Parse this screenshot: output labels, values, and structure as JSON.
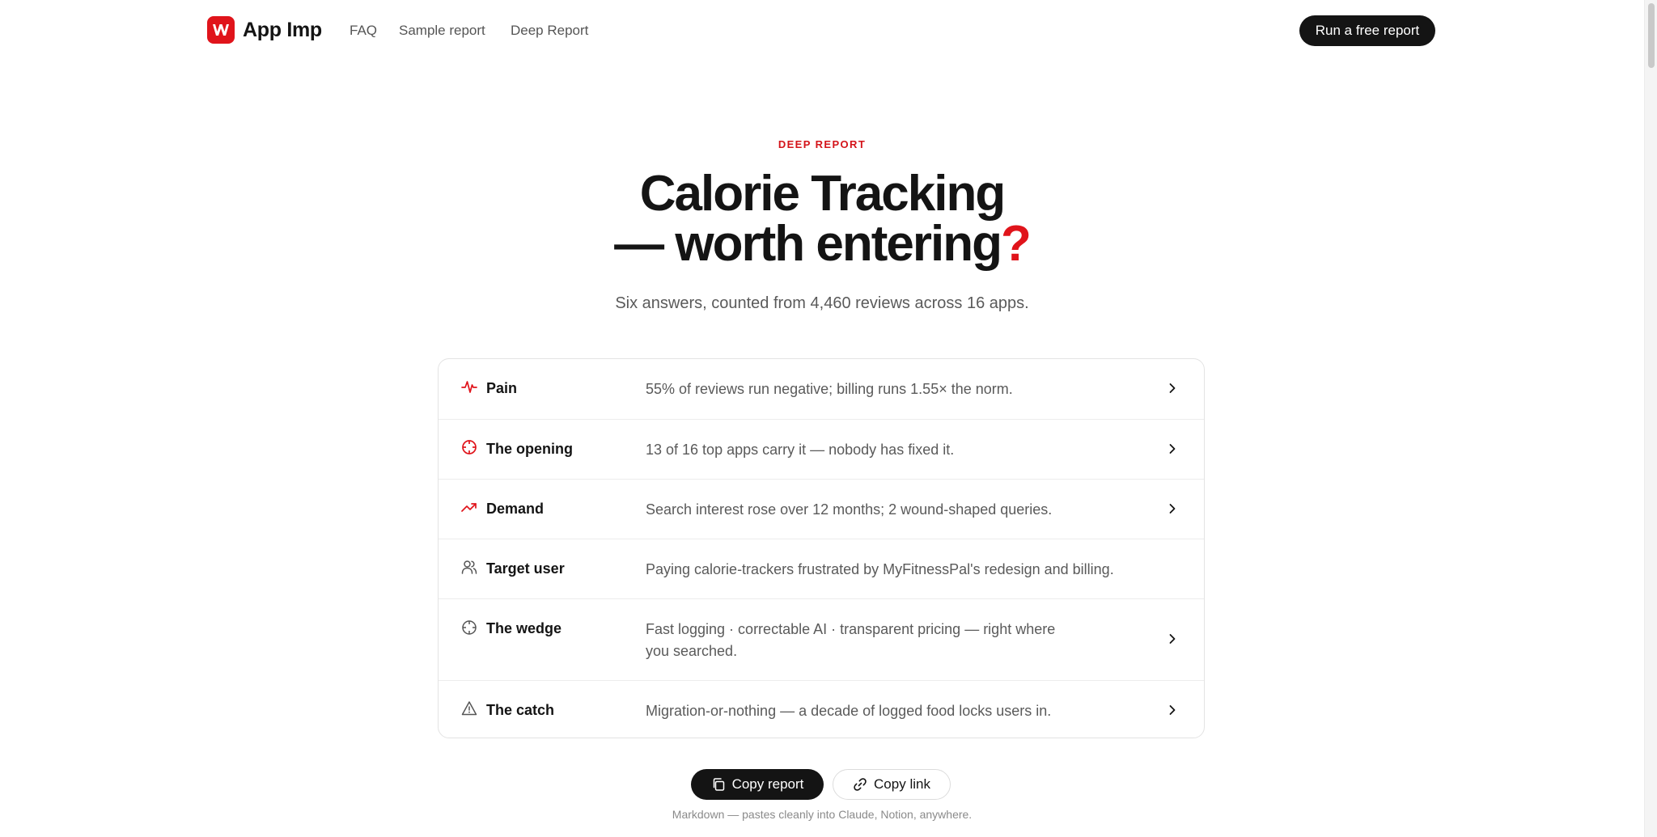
{
  "header": {
    "brand_name": "App Imp",
    "nav": [
      {
        "label": "FAQ"
      },
      {
        "label": "Sample report"
      },
      {
        "label": "Deep Report"
      }
    ],
    "cta_label": "Run a free report"
  },
  "hero": {
    "eyebrow": "DEEP REPORT",
    "title_line1": "Calorie Tracking",
    "title_line2": "— worth entering",
    "title_mark": "?",
    "subtitle": "Six answers, counted from 4,460 reviews across 16 apps."
  },
  "rows": [
    {
      "label": "Pain",
      "text": "55% of reviews run negative; billing runs 1.55× the norm.",
      "icon": "pulse-icon",
      "expandable": true
    },
    {
      "label": "The opening",
      "text": "13 of 16 top apps carry it — nobody has fixed it.",
      "icon": "crosshair-icon",
      "expandable": true
    },
    {
      "label": "Demand",
      "text": "Search interest rose over 12 months; 2 wound-shaped queries.",
      "icon": "trend-up-icon",
      "expandable": true
    },
    {
      "label": "Target user",
      "text": "Paying calorie-trackers frustrated by MyFitnessPal's redesign and billing.",
      "icon": "users-icon",
      "expandable": false
    },
    {
      "label": "The wedge",
      "text_line1": "Fast logging · correctable AI · transparent pricing — right where",
      "text_line2": "you searched.",
      "icon": "target-icon",
      "expandable": true
    },
    {
      "label": "The catch",
      "text": "Migration-or-nothing — a decade of logged food locks users in.",
      "icon": "warning-icon",
      "expandable": true
    }
  ],
  "actions": {
    "copy_report_label": "Copy report",
    "copy_link_label": "Copy link",
    "footnote": "Markdown — pastes cleanly into Claude, Notion, anywhere."
  },
  "colors": {
    "accent": "#e0141b",
    "text": "#141414",
    "muted": "#5a5a5a"
  }
}
